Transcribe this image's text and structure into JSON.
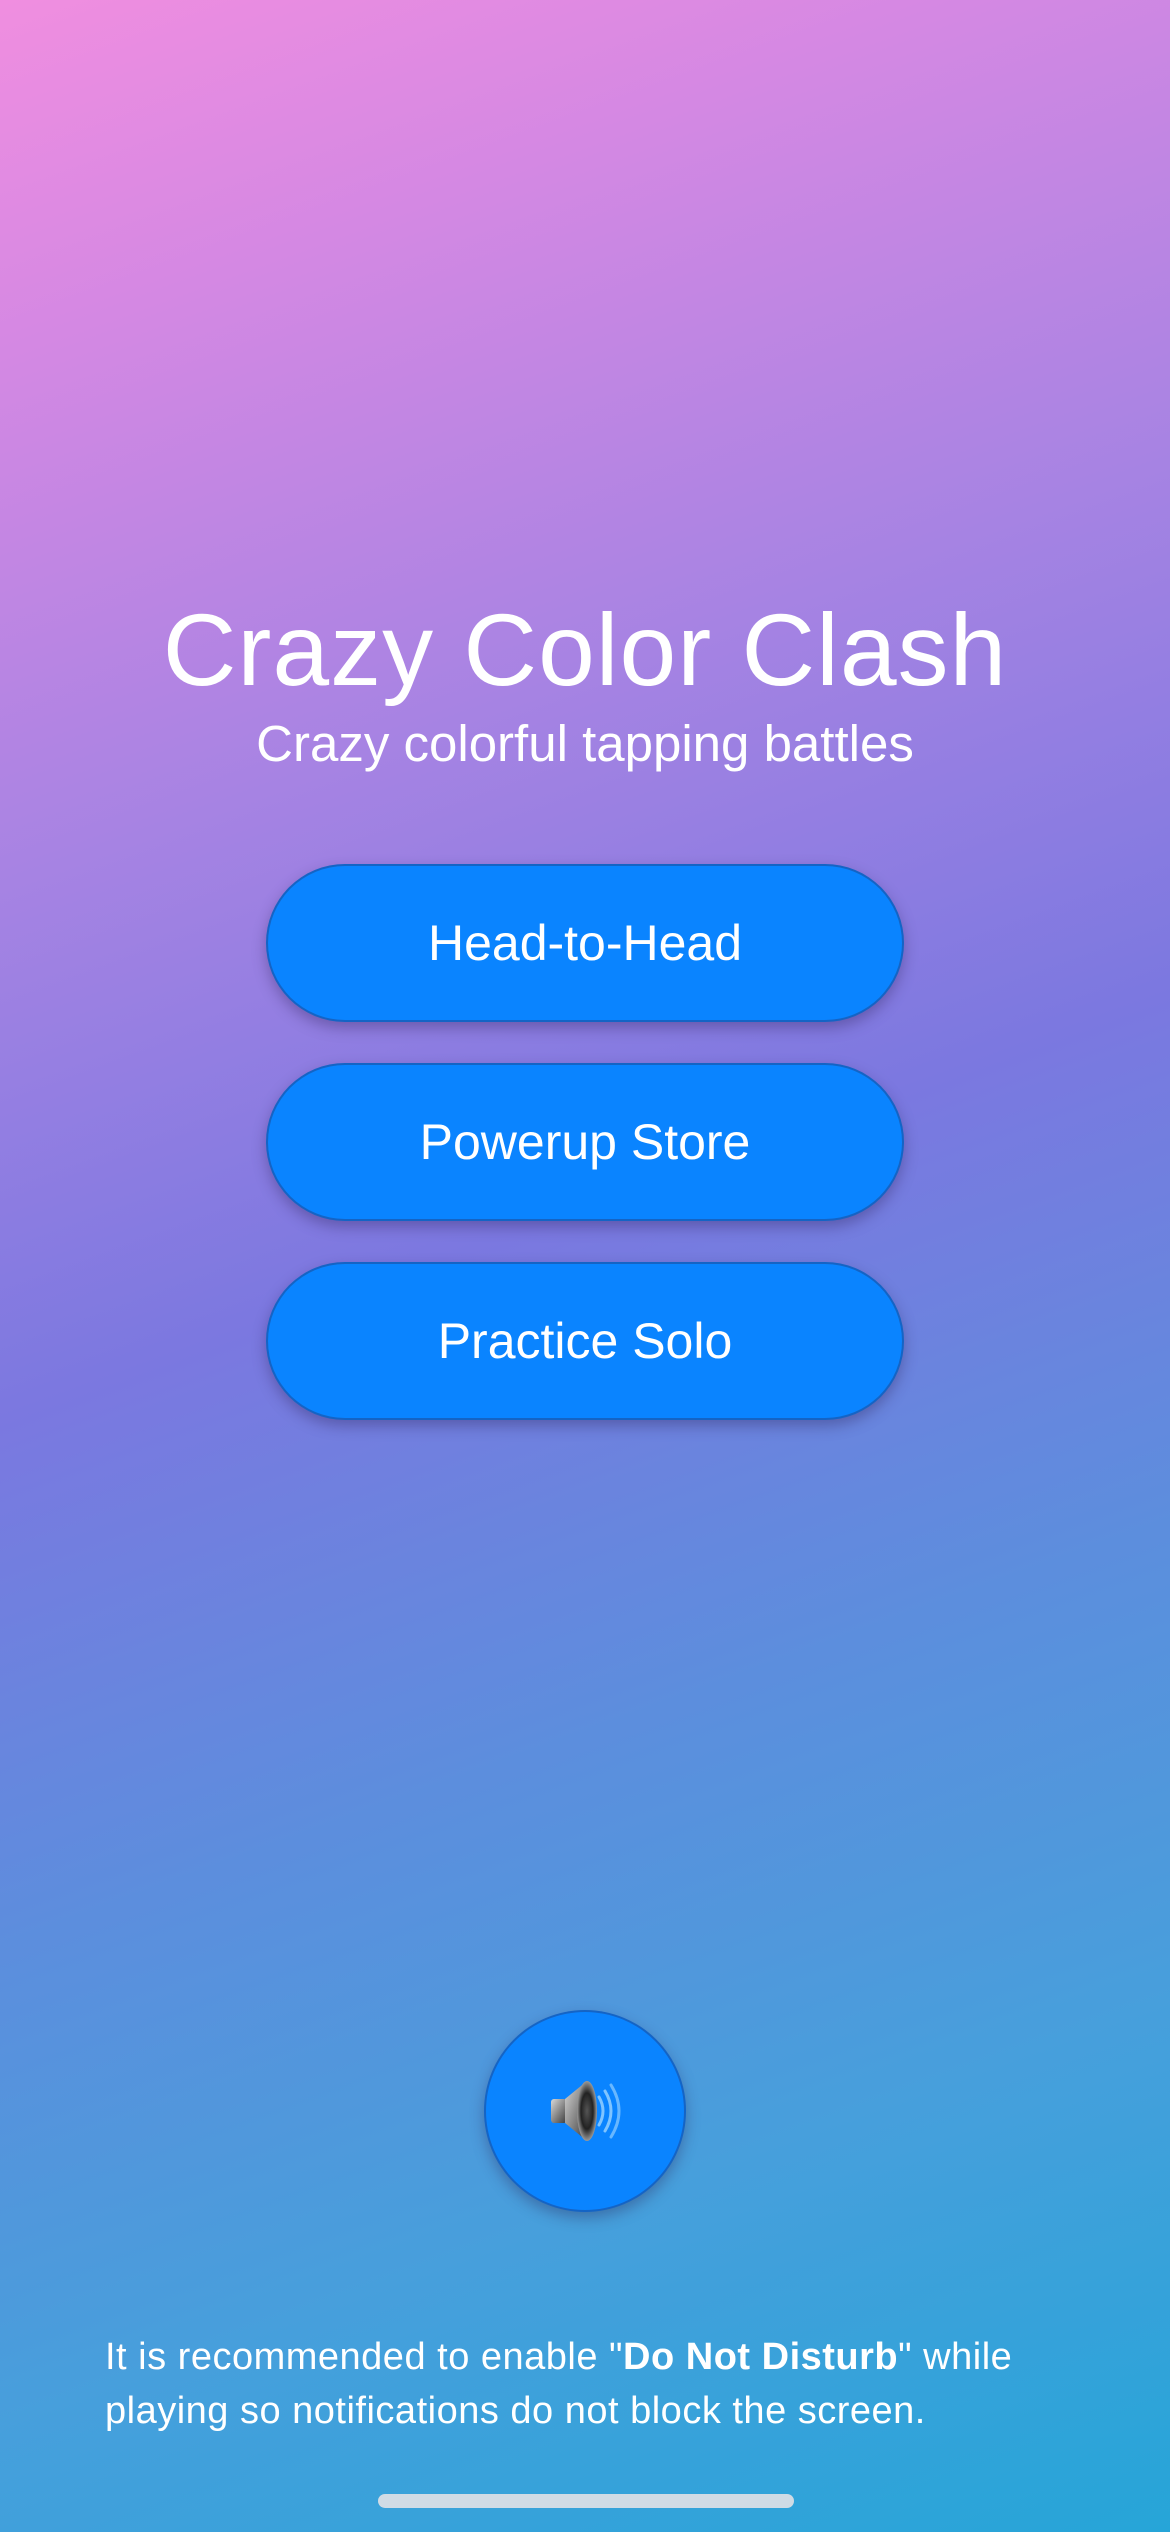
{
  "app": {
    "title": "Crazy Color Clash",
    "subtitle": "Crazy colorful tapping battles"
  },
  "menu": {
    "buttons": [
      {
        "label": "Head-to-Head"
      },
      {
        "label": "Powerup Store"
      },
      {
        "label": "Practice Solo"
      }
    ]
  },
  "sound_button": {
    "icon": "speaker-icon"
  },
  "note": {
    "prefix": "It is recommended to enable \"",
    "bold": "Do Not Disturb",
    "suffix": "\" while playing so notifications do not block the screen."
  },
  "colors": {
    "button": "#0a84ff",
    "gradient_top": "#f08ee0",
    "gradient_bottom": "#26a5d8",
    "text": "#ffffff"
  }
}
